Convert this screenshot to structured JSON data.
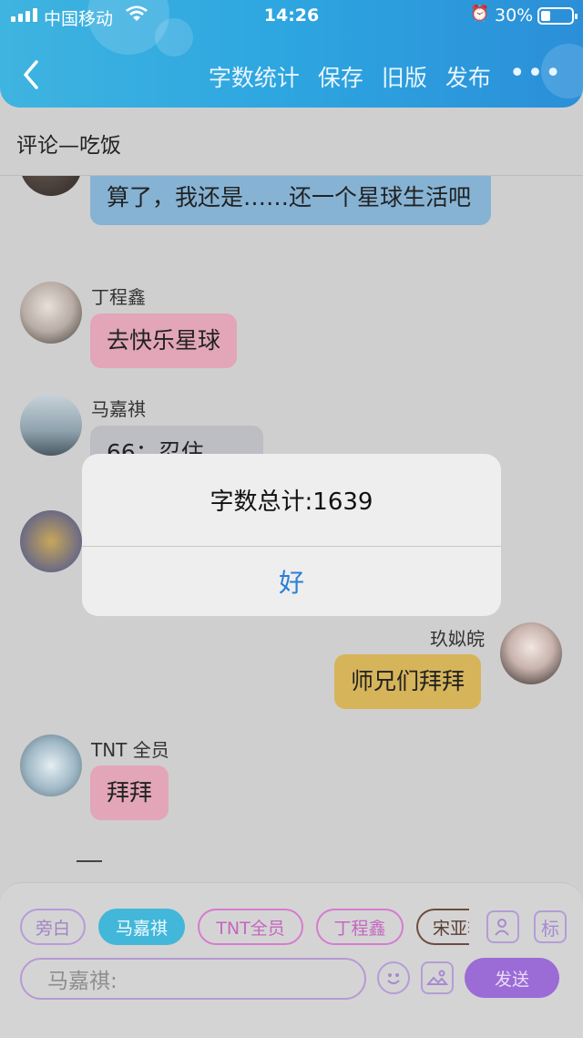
{
  "status_bar": {
    "carrier": "中国移动",
    "time": "14:26",
    "battery": "30%",
    "battery_level": 0.3
  },
  "nav": {
    "actions": [
      "字数统计",
      "保存",
      "旧版",
      "发布"
    ],
    "more": "•••"
  },
  "title": "评论—吃饭",
  "messages": [
    {
      "name": "",
      "text": "算了，我还是……还一个星球生活吧"
    },
    {
      "name": "丁程鑫",
      "text": "去快乐星球"
    },
    {
      "name": "马嘉祺",
      "text": "66：忍住"
    },
    {
      "name": "玖姒皖",
      "text": "师兄们拜拜"
    },
    {
      "name": "TNT 全员",
      "text": "拜拜"
    }
  ],
  "dialog": {
    "message": "字数总计:1639",
    "ok": "好"
  },
  "roles": [
    "旁白",
    "马嘉祺",
    "TNT全员",
    "丁程鑫",
    "宋亚轩"
  ],
  "toolbar": {
    "tag_icon": "标"
  },
  "composer": {
    "placeholder": "马嘉祺:",
    "send": "发送"
  },
  "colors": {
    "header": "#2da5e0",
    "bubble_blue": "#86b3d4",
    "bubble_pink": "#e2a6b8",
    "bubble_yellow": "#d6b45a",
    "send": "#9b6bd6"
  }
}
